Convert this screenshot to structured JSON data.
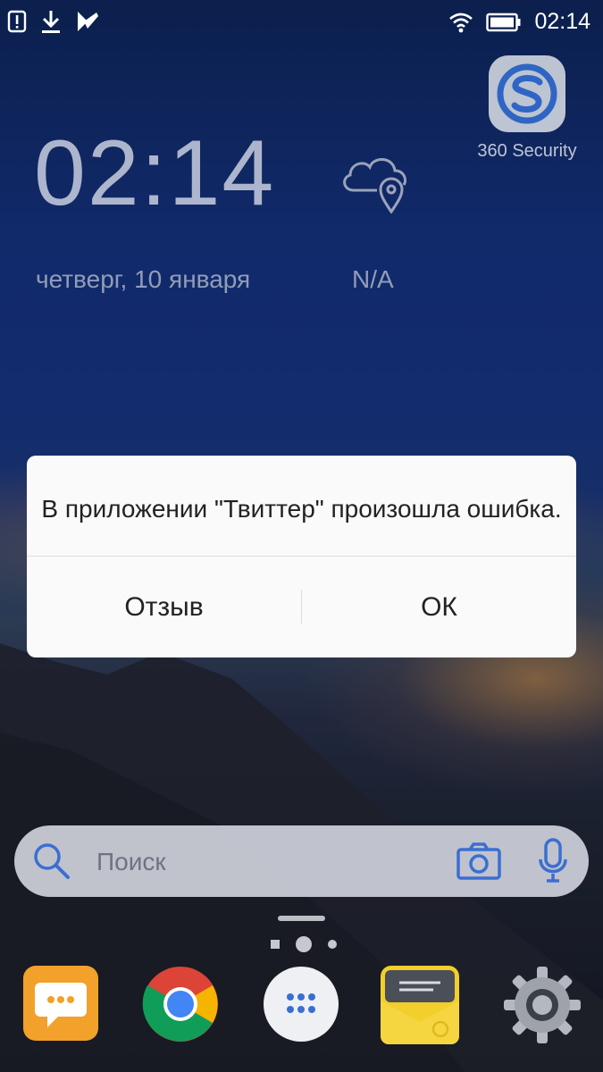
{
  "status_bar": {
    "time": "02:14",
    "left_icons": [
      "alert-icon",
      "download-icon",
      "app-notification-icon"
    ],
    "right_icons": [
      "wifi-icon",
      "battery-icon"
    ]
  },
  "clock_widget": {
    "time": "02:14",
    "date": "четверг, 10 января",
    "weather": "N/A"
  },
  "desktop_app": {
    "label": "360 Security"
  },
  "dialog": {
    "message": "В приложении \"Твиттер\" произошла ошибка.",
    "feedback_label": "Отзыв",
    "ok_label": "ОК"
  },
  "search": {
    "placeholder": "Поиск"
  },
  "page_indicator": {
    "pages": 3,
    "active_page": 2
  },
  "dock": [
    {
      "name": "messages",
      "icon": "messages-icon"
    },
    {
      "name": "chrome",
      "icon": "chrome-icon"
    },
    {
      "name": "app-drawer",
      "icon": "app-drawer-icon"
    },
    {
      "name": "email",
      "icon": "email-icon"
    },
    {
      "name": "settings",
      "icon": "settings-icon"
    }
  ],
  "colors": {
    "accent_blue": "#3a6fd1",
    "dialog_bg": "#fafafa",
    "messages_orange": "#f2a12a",
    "email_yellow": "#f2cf2a"
  }
}
